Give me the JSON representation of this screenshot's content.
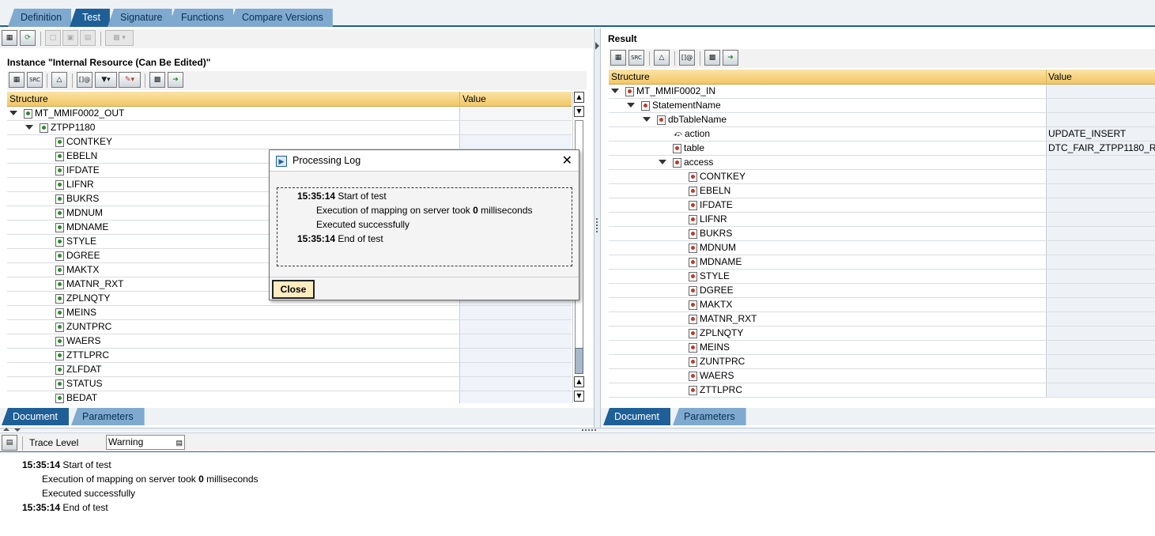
{
  "tabs": [
    "Definition",
    "Test",
    "Signature",
    "Functions",
    "Compare Versions"
  ],
  "active_tab": "Test",
  "left_panel": {
    "heading": "Instance \"Internal Resource (Can Be Edited)\"",
    "col_structure": "Structure",
    "col_value": "Value",
    "root": "MT_MMIF0002_OUT",
    "child": "ZTPP1180",
    "fields": [
      "CONTKEY",
      "EBELN",
      "IFDATE",
      "LIFNR",
      "BUKRS",
      "MDNUM",
      "MDNAME",
      "STYLE",
      "DGREE",
      "MAKTX",
      "MATNR_RXT",
      "ZPLNQTY",
      "MEINS",
      "ZUNTPRC",
      "WAERS",
      "ZTTLPRC",
      "ZLFDAT",
      "STATUS",
      "BEDAT"
    ],
    "bottom_tabs": [
      "Document",
      "Parameters"
    ]
  },
  "right_panel": {
    "heading": "Result",
    "col_structure": "Structure",
    "col_value": "Value",
    "root": "MT_MMIF0002_IN",
    "statement": "StatementName",
    "dbtable": "dbTableName",
    "action_label": "action",
    "action_value": "UPDATE_INSERT",
    "table_label": "table",
    "table_value": "DTC_FAIR_ZTPP1180_R",
    "access_label": "access",
    "fields": [
      "CONTKEY",
      "EBELN",
      "IFDATE",
      "LIFNR",
      "BUKRS",
      "MDNUM",
      "MDNAME",
      "STYLE",
      "DGREE",
      "MAKTX",
      "MATNR_RXT",
      "ZPLNQTY",
      "MEINS",
      "ZUNTPRC",
      "WAERS",
      "ZTTLPRC"
    ],
    "bottom_tabs": [
      "Document",
      "Parameters"
    ]
  },
  "dialog": {
    "title": "Processing Log",
    "close_label": "Close",
    "log": {
      "time1": "15:35:14",
      "text1": " Start of test",
      "line2a": "Execution of mapping on server took ",
      "line2b": "0",
      "line2c": " milliseconds",
      "line3": "Executed successfully",
      "time4": "15:35:14",
      "text4": " End of test"
    }
  },
  "trace": {
    "label": "Trace Level",
    "value": "Warning"
  },
  "bottom_log": {
    "time1": "15:35:14",
    "text1": " Start of test",
    "line2a": "Execution of mapping on server took ",
    "line2b": "0",
    "line2c": " milliseconds",
    "line3": "Executed successfully",
    "time4": "15:35:14",
    "text4": " End of test"
  },
  "colors": {
    "tab_active": "#1f5f97",
    "tab_inactive": "#7fa9cf",
    "header_gold": "#f2c765",
    "value_cell": "#eef2f7"
  }
}
